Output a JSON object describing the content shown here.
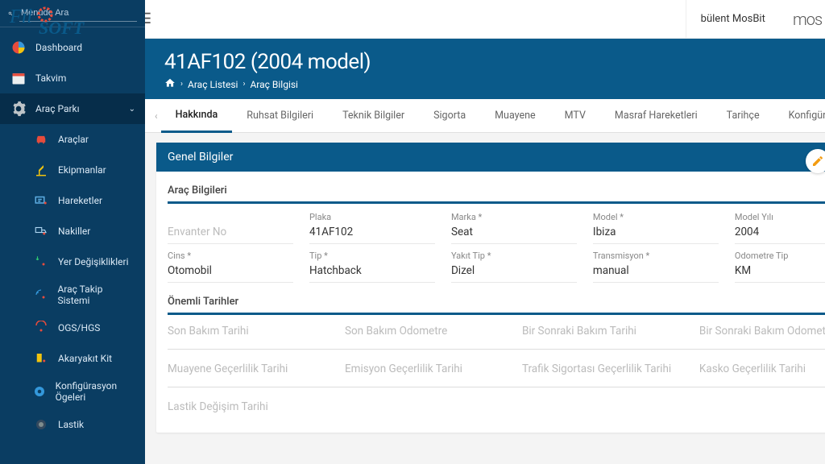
{
  "topbar": {
    "user": "bülent MosBit"
  },
  "sidebar": {
    "search_placeholder": "Menüde Ara",
    "items": [
      {
        "label": "Dashboard"
      },
      {
        "label": "Takvim"
      },
      {
        "label": "Araç Parkı",
        "expandable": true
      },
      {
        "label": "Araçlar"
      },
      {
        "label": "Ekipmanlar"
      },
      {
        "label": "Hareketler"
      },
      {
        "label": "Nakiller"
      },
      {
        "label": "Yer Değişiklikleri"
      },
      {
        "label": "Araç Takip Sistemi"
      },
      {
        "label": "OGS/HGS"
      },
      {
        "label": "Akaryakıt Kit"
      },
      {
        "label": "Konfigürasyon Ögeleri"
      },
      {
        "label": "Lastik"
      }
    ]
  },
  "page": {
    "title": "41AF102 (2004 model)",
    "breadcrumb": [
      "Araç Listesi",
      "Araç Bilgisi"
    ]
  },
  "tabs": [
    "Hakkında",
    "Ruhsat Bilgileri",
    "Teknik Bilgiler",
    "Sigorta",
    "Muayene",
    "MTV",
    "Masraf Hareketleri",
    "Tarihçe",
    "Konfigürasyon"
  ],
  "card": {
    "title": "Genel Bilgiler",
    "section1": {
      "title": "Araç Bilgileri",
      "row1": [
        {
          "label": "",
          "value": "Envanter No",
          "placeholder": true
        },
        {
          "label": "Plaka",
          "value": "41AF102"
        },
        {
          "label": "Marka *",
          "value": "Seat"
        },
        {
          "label": "Model *",
          "value": "Ibiza"
        },
        {
          "label": "Model Yılı",
          "value": "2004"
        }
      ],
      "row2": [
        {
          "label": "Cins *",
          "value": "Otomobil"
        },
        {
          "label": "Tip *",
          "value": "Hatchback"
        },
        {
          "label": "Yakıt Tip *",
          "value": "Dizel"
        },
        {
          "label": "Transmisyon *",
          "value": "manual"
        },
        {
          "label": "Odometre Tip",
          "value": "KM"
        }
      ]
    },
    "section2": {
      "title": "Önemli Tarihler",
      "row1": [
        {
          "label": "Son Bakım Tarihi"
        },
        {
          "label": "Son Bakım Odometre"
        },
        {
          "label": "Bir Sonraki Bakım Tarihi"
        },
        {
          "label": "Bir Sonraki Bakım Odometre"
        }
      ],
      "row2": [
        {
          "label": "Muayene Geçerlilik Tarihi"
        },
        {
          "label": "Emisyon Geçerlilik Tarihi"
        },
        {
          "label": "Trafik Sigortası Geçerlilik Tarihi"
        },
        {
          "label": "Kasko Geçerlilik Tarihi"
        }
      ],
      "row3": [
        {
          "label": "Lastik Değişim Tarihi"
        },
        {
          "label": ""
        },
        {
          "label": ""
        },
        {
          "label": ""
        }
      ]
    }
  }
}
